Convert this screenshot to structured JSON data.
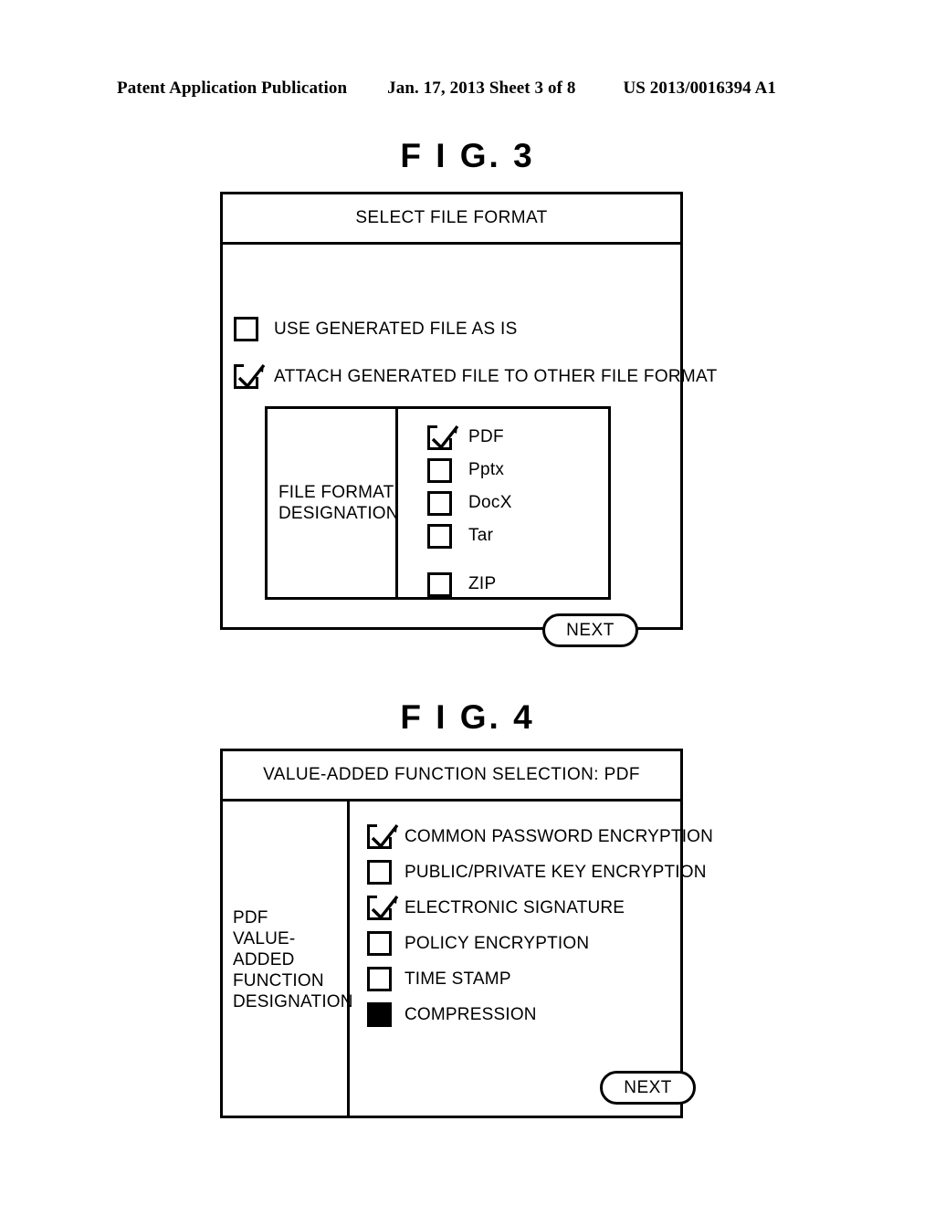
{
  "header": {
    "publication": "Patent Application Publication",
    "date_sheet": "Jan. 17, 2013  Sheet 3 of 8",
    "patent_number": "US 2013/0016394 A1"
  },
  "figures": [
    {
      "title": "F I G.  3",
      "dialog_title": "SELECT FILE FORMAT",
      "options": [
        {
          "label": "USE GENERATED FILE AS IS",
          "state": "unchecked"
        },
        {
          "label": "ATTACH GENERATED FILE TO OTHER FILE FORMAT",
          "state": "checked"
        }
      ],
      "panel": {
        "label": "FILE FORMAT\nDESIGNATION",
        "label_line1": "FILE FORMAT",
        "label_line2": "DESIGNATION",
        "items": [
          {
            "label": "PDF",
            "state": "checked",
            "gap_before": false
          },
          {
            "label": "Pptx",
            "state": "unchecked",
            "gap_before": false
          },
          {
            "label": "DocX",
            "state": "unchecked",
            "gap_before": false
          },
          {
            "label": "Tar",
            "state": "unchecked",
            "gap_before": false
          },
          {
            "label": "ZIP",
            "state": "unchecked",
            "gap_before": true
          }
        ]
      },
      "next_label": "NEXT"
    },
    {
      "title": "F I G.  4",
      "dialog_title": "VALUE-ADDED FUNCTION SELECTION:  PDF",
      "panel": {
        "label_line1": "PDF",
        "label_line2": "VALUE-ADDED",
        "label_line3": "FUNCTION",
        "label_line4": "DESIGNATION",
        "items": [
          {
            "label": "COMMON PASSWORD ENCRYPTION",
            "state": "checked"
          },
          {
            "label": "PUBLIC/PRIVATE KEY ENCRYPTION",
            "state": "unchecked"
          },
          {
            "label": "ELECTRONIC SIGNATURE",
            "state": "checked"
          },
          {
            "label": "POLICY ENCRYPTION",
            "state": "unchecked"
          },
          {
            "label": "TIME STAMP",
            "state": "unchecked"
          },
          {
            "label": "COMPRESSION",
            "state": "filled"
          }
        ]
      },
      "next_label": "NEXT"
    }
  ],
  "colors": {
    "ink": "#000000",
    "paper": "#ffffff"
  }
}
